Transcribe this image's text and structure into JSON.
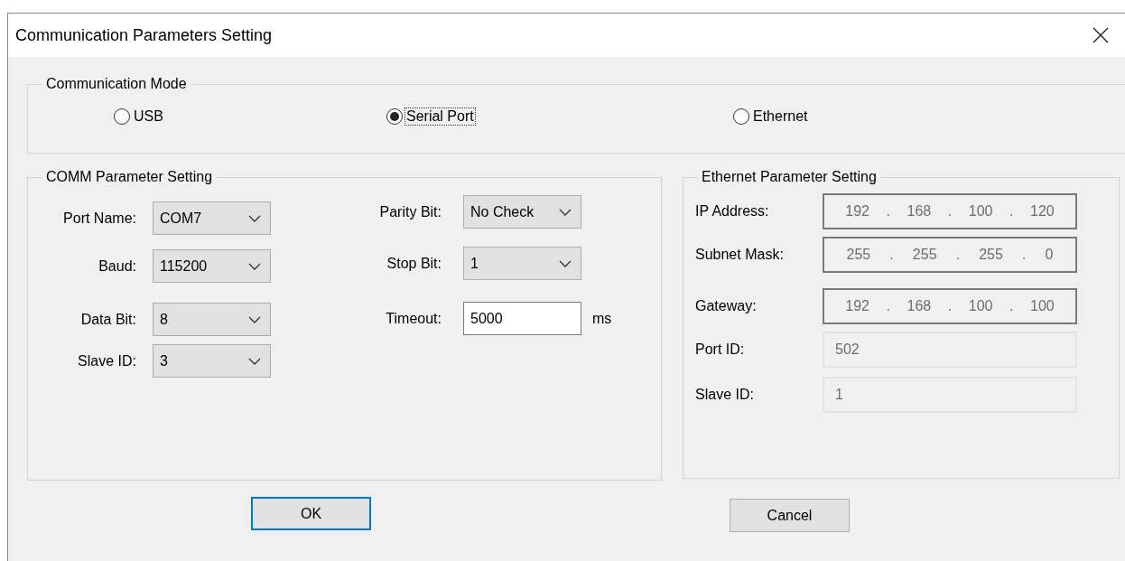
{
  "window": {
    "title": "Communication Parameters Setting"
  },
  "communication_mode": {
    "title": "Communication Mode",
    "options": [
      {
        "label": "USB",
        "selected": false,
        "focused": false
      },
      {
        "label": "Serial Port",
        "selected": true,
        "focused": true
      },
      {
        "label": "Ethernet",
        "selected": false,
        "focused": false
      }
    ]
  },
  "comm_parameters": {
    "title": "COMM Parameter Setting",
    "columns": [
      [
        {
          "label": "Port Name:",
          "kind": "combo",
          "value": "COM7"
        },
        {
          "label": "Baud:",
          "kind": "combo",
          "value": "115200"
        },
        {
          "label": "Data Bit:",
          "kind": "combo",
          "value": "8"
        },
        {
          "label": "Slave ID:",
          "kind": "combo",
          "value": "3"
        }
      ],
      [
        {
          "label": "Parity Bit:",
          "kind": "combo",
          "value": "No Check"
        },
        {
          "label": "Stop Bit:",
          "kind": "combo",
          "value": "1"
        },
        {
          "label": "Timeout:",
          "kind": "text",
          "value": "5000",
          "unit": "ms"
        }
      ]
    ]
  },
  "ethernet_parameters": {
    "title": "Ethernet Parameter Setting",
    "fields": [
      {
        "label": "IP Address:",
        "kind": "ip",
        "octets": [
          "192",
          "168",
          "100",
          "120"
        ],
        "separator": ".",
        "disabled": true
      },
      {
        "label": "Subnet Mask:",
        "kind": "ip",
        "octets": [
          "255",
          "255",
          "255",
          "0"
        ],
        "separator": ".",
        "disabled": true
      },
      {
        "label": "Gateway:",
        "kind": "ip",
        "octets": [
          "192",
          "168",
          "100",
          "100"
        ],
        "separator": ".",
        "disabled": true
      },
      {
        "label": "Port ID:",
        "kind": "text",
        "value": "502",
        "disabled": true
      },
      {
        "label": "Slave ID:",
        "kind": "text",
        "value": "1",
        "disabled": true
      }
    ]
  },
  "buttons": [
    {
      "label": "OK",
      "focused": true
    },
    {
      "label": "Cancel",
      "focused": false
    }
  ]
}
